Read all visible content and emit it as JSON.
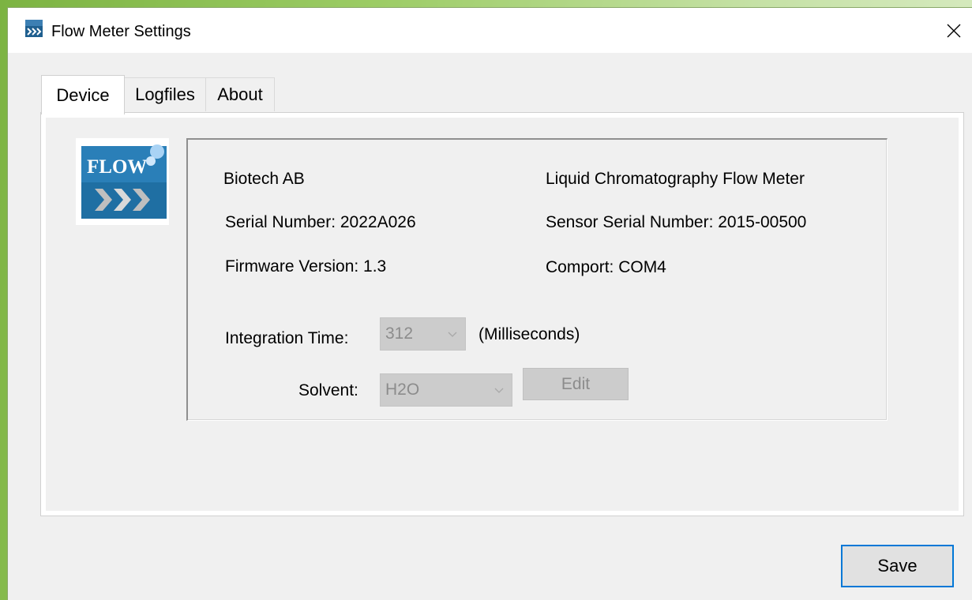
{
  "window": {
    "title": "Flow Meter Settings",
    "close_glyph": "✕",
    "icon": "flow-app-icon"
  },
  "tabs": [
    {
      "label": "Device",
      "selected": true
    },
    {
      "label": "Logfiles",
      "selected": false
    },
    {
      "label": "About",
      "selected": false
    }
  ],
  "device": {
    "logo_text": "FLOW",
    "manufacturer": "Biotech AB",
    "product": "Liquid Chromatography Flow Meter",
    "serial_number": "Serial Number: 2022A026",
    "sensor_serial_number": "Sensor Serial Number: 2015-00500",
    "firmware_version": "Firmware Version: 1.3",
    "comport": "Comport: COM4",
    "integration_time_label": "Integration Time:",
    "integration_time_value": "312",
    "integration_time_unit": "(Milliseconds)",
    "solvent_label": "Solvent:",
    "solvent_value": "H2O",
    "edit_label": "Edit"
  },
  "footer": {
    "save_label": "Save"
  },
  "colors": {
    "accent_blue": "#0078d7",
    "logo_blue": "#1f6fa3",
    "disabled_bg": "#cccccc",
    "disabled_text": "#8c8c8c"
  }
}
